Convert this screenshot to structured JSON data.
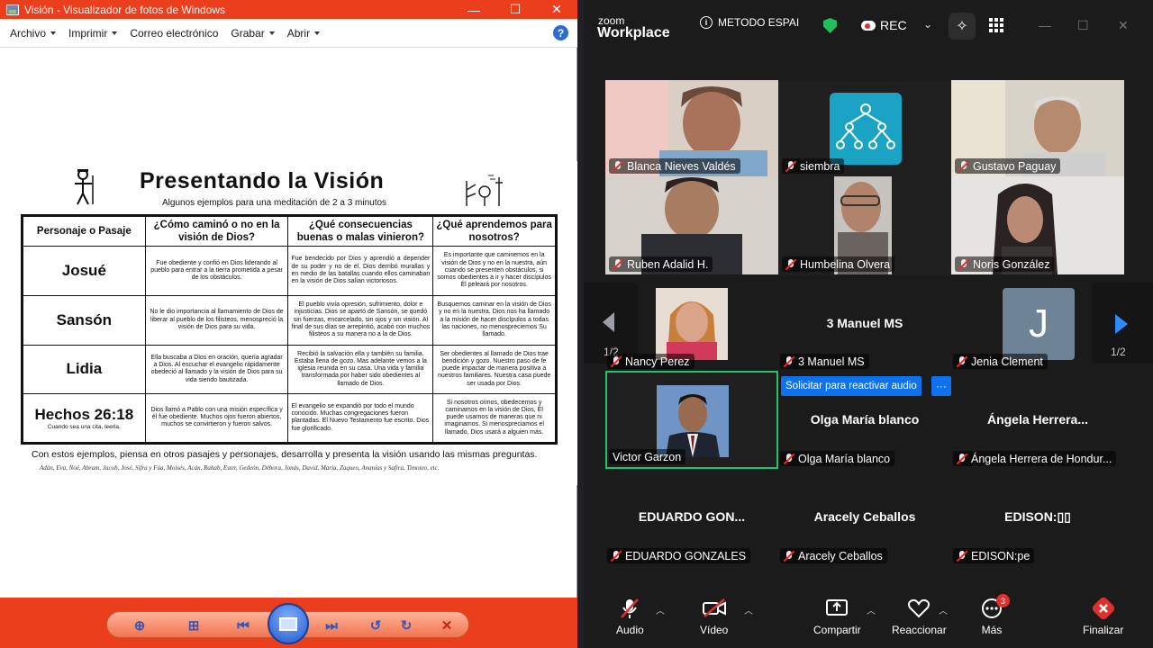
{
  "viewer": {
    "title": "Visión - Visualizador de fotos de Windows",
    "menu": [
      "Archivo",
      "Imprimir",
      "Correo electrónico",
      "Grabar",
      "Abrir"
    ]
  },
  "document": {
    "title": "Presentando la Visión",
    "subtitle": "Algunos ejemplos para una meditación de 2 a 3 minutos",
    "headers": [
      "Personaje o Pasaje",
      "¿Cómo caminó o no en la visión de Dios?",
      "¿Qué consecuencias buenas o malas vinieron?",
      "¿Qué aprendemos para nosotros?"
    ],
    "rows": [
      {
        "name": "Josué",
        "c1": "Fue obediente y confió en Dios liderando al pueblo para entrar a la tierra prometida a pesar de los obstáculos.",
        "c2": "Fue bendecido por Dios y aprendió a depender de su poder y no de él. Dios derribó murallas y en medio de las batallas cuando ellos caminaban en la visión de Dios salían victoriosos.",
        "c3": "Es importante que caminemos en la visión de Dios y no en la nuestra, aún cuando se presenten obstáculos, si somos obedientes a ir y hacer discípulos Él peleará por nosotros."
      },
      {
        "name": "Sansón",
        "c1": "No le dio importancia al llamamiento de Dios de liberar al pueblo de los filisteos, menospreció la visión de Dios para su vida.",
        "c2": "El pueblo vivía opresión, sufrimiento, dolor e injusticias. Dios se apartó de Sansón, se quedó sin fuerzas, encarcelado, sin ojos y sin visión. Al final de sus días se arrepintió, acabó con muchos filisteos a su manera no a la de Dios.",
        "c3": "Busquemos caminar en la visión de Dios y no en la nuestra. Dios nos ha llamado a la misión de hacer discípulos a todas las naciones, no menospreciemos Su llamado."
      },
      {
        "name": "Lidia",
        "c1": "Ella buscaba a Dios en oración, quería agradar a Dios. Al escuchar el evangelio rápidamente obedeció al llamado y la visión de Dios para su vida siendo bautizada.",
        "c2": "Recibió la salvación ella y también su familia. Estaba llena de gozo. Mas adelante vemos a la iglesia reunida en su casa. Una vida y familia transformada por haber sido obedientes al llamado de Dios.",
        "c3": "Ser obedientes al llamado de Dios trae bendición y gozo. Nuestro paso de fe puede impactar de manera positiva a nuestros familiares. Nuestra casa puede ser usada por Dios."
      },
      {
        "name": "Hechos 26:18",
        "note": "Cuando sea una cita, leerla.",
        "c1": "Dios llamó a Pablo con una misión específica y él fue obediente. Muchos ojos fueron abiertos, muchos se convirtieron y fueron salvos.",
        "c2": "El evangelio se expandió por todo el mundo conocido. Muchas congregaciones fueron plantadas. El Nuevo Testamento fue escrito. Dios fue glorificado.",
        "c3": "Si nosotros oímos, obedecemos y caminamos en la visión de Dios, Él puede usarnos de maneras que ni imaginamos. Si menospreciamos el llamado, Dios usará a alguien más."
      }
    ],
    "footer": "Con estos ejemplos, piensa en otros pasajes y personajes, desarrolla y presenta la visión usando las mismas preguntas.",
    "names_line": "Adán, Eva, Noé, Abram, Jacob, José, Sifra y Fúa, Moisés, Acán, Rahab, Ester, Gedeón, Débora, Jonás, David, María, Zaqueo, Ananías y Safira, Timoteo, etc."
  },
  "zoom": {
    "logo_top": "zoom",
    "logo_bottom": "Workplace",
    "meeting": "METODO ESPAI",
    "rec": "REC",
    "participants": [
      {
        "name": "Blanca Nieves Valdés"
      },
      {
        "name": "siembra"
      },
      {
        "name": "Gustavo Paguay"
      },
      {
        "name": "Ruben Adalid H."
      },
      {
        "name": "Humbelina Olvera"
      },
      {
        "name": "Noris González"
      },
      {
        "name": "Nancy Perez"
      },
      {
        "name": "3 Manuel MS",
        "display": "3 Manuel MS"
      },
      {
        "name": "Jenia Clement",
        "initial": "J"
      },
      {
        "name": "Victor Garzon"
      },
      {
        "name": "Olga María blanco",
        "display": "Olga María blanco"
      },
      {
        "name": "Ángela Herrera de Hondur...",
        "display": "Ángela  Herrera..."
      },
      {
        "name": "EDUARDO GONZALES",
        "display": "EDUARDO  GON..."
      },
      {
        "name": "Aracely Ceballos",
        "display": "Aracely Ceballos"
      },
      {
        "name": "EDISON:pe",
        "display": "EDISON:▯▯"
      }
    ],
    "page_left": "1/2",
    "page_right": "1/2",
    "request_audio": "Solicitar para reactivar audio",
    "more_dots": "···",
    "toolbar": {
      "audio": "Audio",
      "video": "Vídeo",
      "share": "Compartir",
      "react": "Reaccionar",
      "more": "Más",
      "more_badge": "3",
      "end": "Finalizar"
    }
  }
}
